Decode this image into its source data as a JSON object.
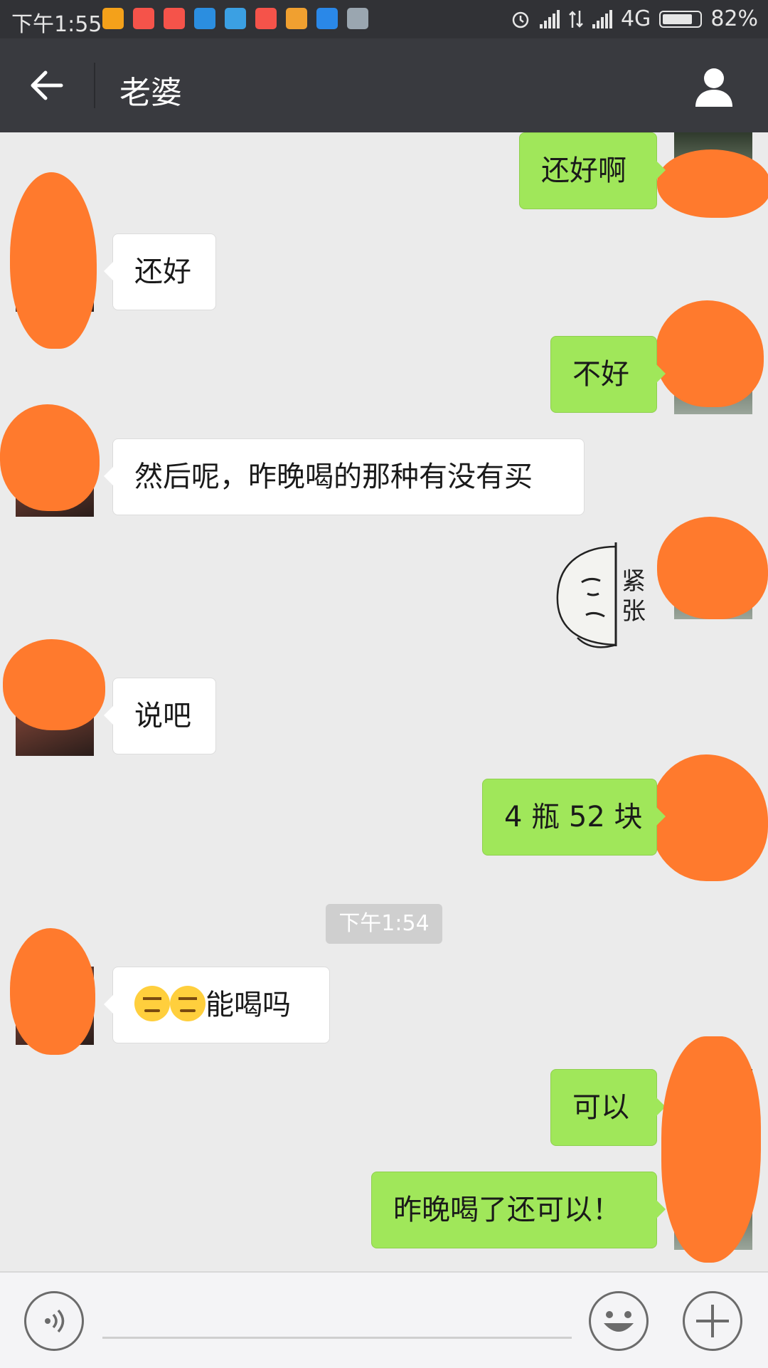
{
  "status_bar": {
    "time": "下午1:55",
    "network": "4G",
    "battery": "82%",
    "battery_level": 0.82,
    "notification_icons": [
      "taobao-icon",
      "suning-icon",
      "suning-icon",
      "wifi-share-icon",
      "upload-icon",
      "suning-icon",
      "cleaner-icon",
      "browser-icon",
      "notes-icon"
    ],
    "notification_colors": [
      "#f4a11a",
      "#f5534a",
      "#f5534a",
      "#2b8ee0",
      "#3ba0e3",
      "#f5534a",
      "#f0a030",
      "#2a88e8",
      "#9aa6b0"
    ]
  },
  "header": {
    "title": "老婆",
    "back_icon": "back-arrow-icon",
    "profile_icon": "person-icon"
  },
  "messages": [
    {
      "side": "out",
      "text": "还好啊"
    },
    {
      "side": "in",
      "text": "还好"
    },
    {
      "side": "out",
      "text": "不好"
    },
    {
      "side": "in",
      "text": "然后呢，昨晚喝的那种有没有买"
    },
    {
      "side": "out",
      "sticker_text": "紧张"
    },
    {
      "side": "in",
      "text": "说吧"
    },
    {
      "side": "out",
      "text": "4 瓶 52 块"
    },
    {
      "side": "in",
      "emoji": "sweat-face-emoji",
      "text": "能喝吗"
    },
    {
      "side": "out",
      "text": "可以"
    },
    {
      "side": "out",
      "text": "昨晚喝了还可以！"
    }
  ],
  "timestamp": "下午1:54",
  "input_bar": {
    "voice_icon": "voice-icon",
    "emoji_icon": "smiley-icon",
    "plus_icon": "plus-icon"
  },
  "colors": {
    "outgoing_bubble": "#a0e75a",
    "incoming_bubble": "#ffffff",
    "header_bg": "#393a3f",
    "redaction": "#ff7a2d"
  }
}
